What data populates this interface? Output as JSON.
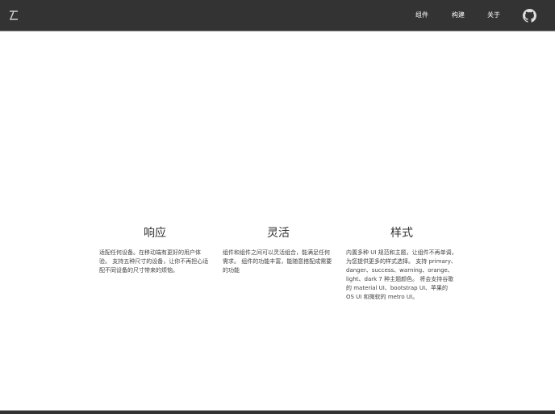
{
  "header": {
    "nav": [
      "组件",
      "构建",
      "关于"
    ]
  },
  "features": [
    {
      "title": "响应",
      "text": "适配任何设备。在移动端有更好的用户体验。 支持五种尺寸的设备，让你不再担心适配不同设备的尺寸带来的烦恼。"
    },
    {
      "title": "灵活",
      "text": "组件和组件之间可以灵活组合，能满足任何需求。 组件的功能丰富，能随意搭配成需要的功能"
    },
    {
      "title": "样式",
      "text": "内置多种 UI 规范和主题，让组件不再单调，为您提供更多的样式选择。 支持 primary、danger、success、warning、orange、light、dark 7 种主题颜色。 将会支持谷歌的 material UI、bootstrap UI、苹果的 OS UI 和微软的 metro UI。"
    }
  ]
}
